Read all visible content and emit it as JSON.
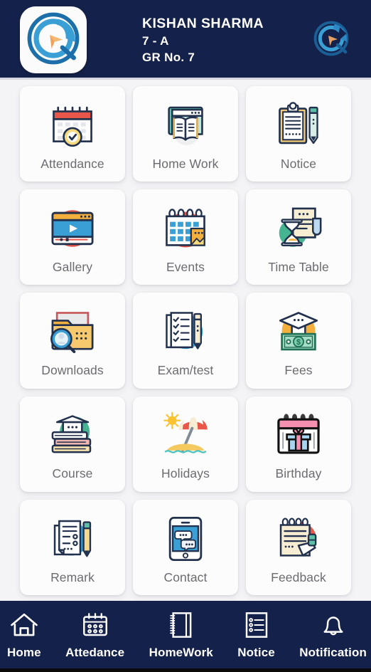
{
  "header": {
    "app_logo_icon": "compass-c-logo-icon",
    "student_name": "KISHAN SHARMA",
    "student_class": "7 - A",
    "student_gr": "GR No. 7",
    "right_mark_icon": "compass-c-mark-icon",
    "background_color": "#14214a"
  },
  "theme": {
    "page_background": "#f4f4f6",
    "tile_background": "#fcfcfc",
    "tile_label_color": "#6b6b72",
    "navy": "#14214a",
    "accent_red": "#e8574a",
    "accent_blue": "#3a9fd4",
    "accent_orange": "#f4b03e",
    "accent_green": "#46b391",
    "accent_pink": "#f58fb0",
    "ink": "#1b2a44"
  },
  "grid": {
    "tiles": [
      {
        "label": "Attendance",
        "icon": "calendar-check-icon",
        "name": "attendance"
      },
      {
        "label": "Home Work",
        "icon": "open-book-window-icon",
        "name": "home-work"
      },
      {
        "label": "Notice",
        "icon": "clipboard-pen-icon",
        "name": "notice"
      },
      {
        "label": "Gallery",
        "icon": "video-player-icon",
        "name": "gallery"
      },
      {
        "label": "Events",
        "icon": "calendar-event-icon",
        "name": "events"
      },
      {
        "label": "Time Table",
        "icon": "hourglass-document-icon",
        "name": "time-table"
      },
      {
        "label": "Downloads",
        "icon": "folder-search-icon",
        "name": "downloads"
      },
      {
        "label": "Exam/test",
        "icon": "checklist-pencil-icon",
        "name": "exam-test"
      },
      {
        "label": "Fees",
        "icon": "graduation-money-icon",
        "name": "fees"
      },
      {
        "label": "Course",
        "icon": "books-cap-icon",
        "name": "course"
      },
      {
        "label": "Holidays",
        "icon": "beach-umbrella-icon",
        "name": "holidays"
      },
      {
        "label": "Birthday",
        "icon": "calendar-gift-icon",
        "name": "birthday"
      },
      {
        "label": "Remark",
        "icon": "document-pencil-icon",
        "name": "remark"
      },
      {
        "label": "Contact",
        "icon": "tablet-chat-icon",
        "name": "contact"
      },
      {
        "label": "Feedback",
        "icon": "notepad-eraser-icon",
        "name": "feedback"
      }
    ]
  },
  "bottom_nav": {
    "items": [
      {
        "label": "Home",
        "icon": "home-icon",
        "name": "home"
      },
      {
        "label": "Attedance",
        "icon": "calendar-dots-icon",
        "name": "attedance"
      },
      {
        "label": "HomeWork",
        "icon": "notebook-icon",
        "name": "homework"
      },
      {
        "label": "Notice",
        "icon": "list-icon",
        "name": "notice"
      },
      {
        "label": "Notification",
        "icon": "bell-icon",
        "name": "notification"
      }
    ]
  }
}
